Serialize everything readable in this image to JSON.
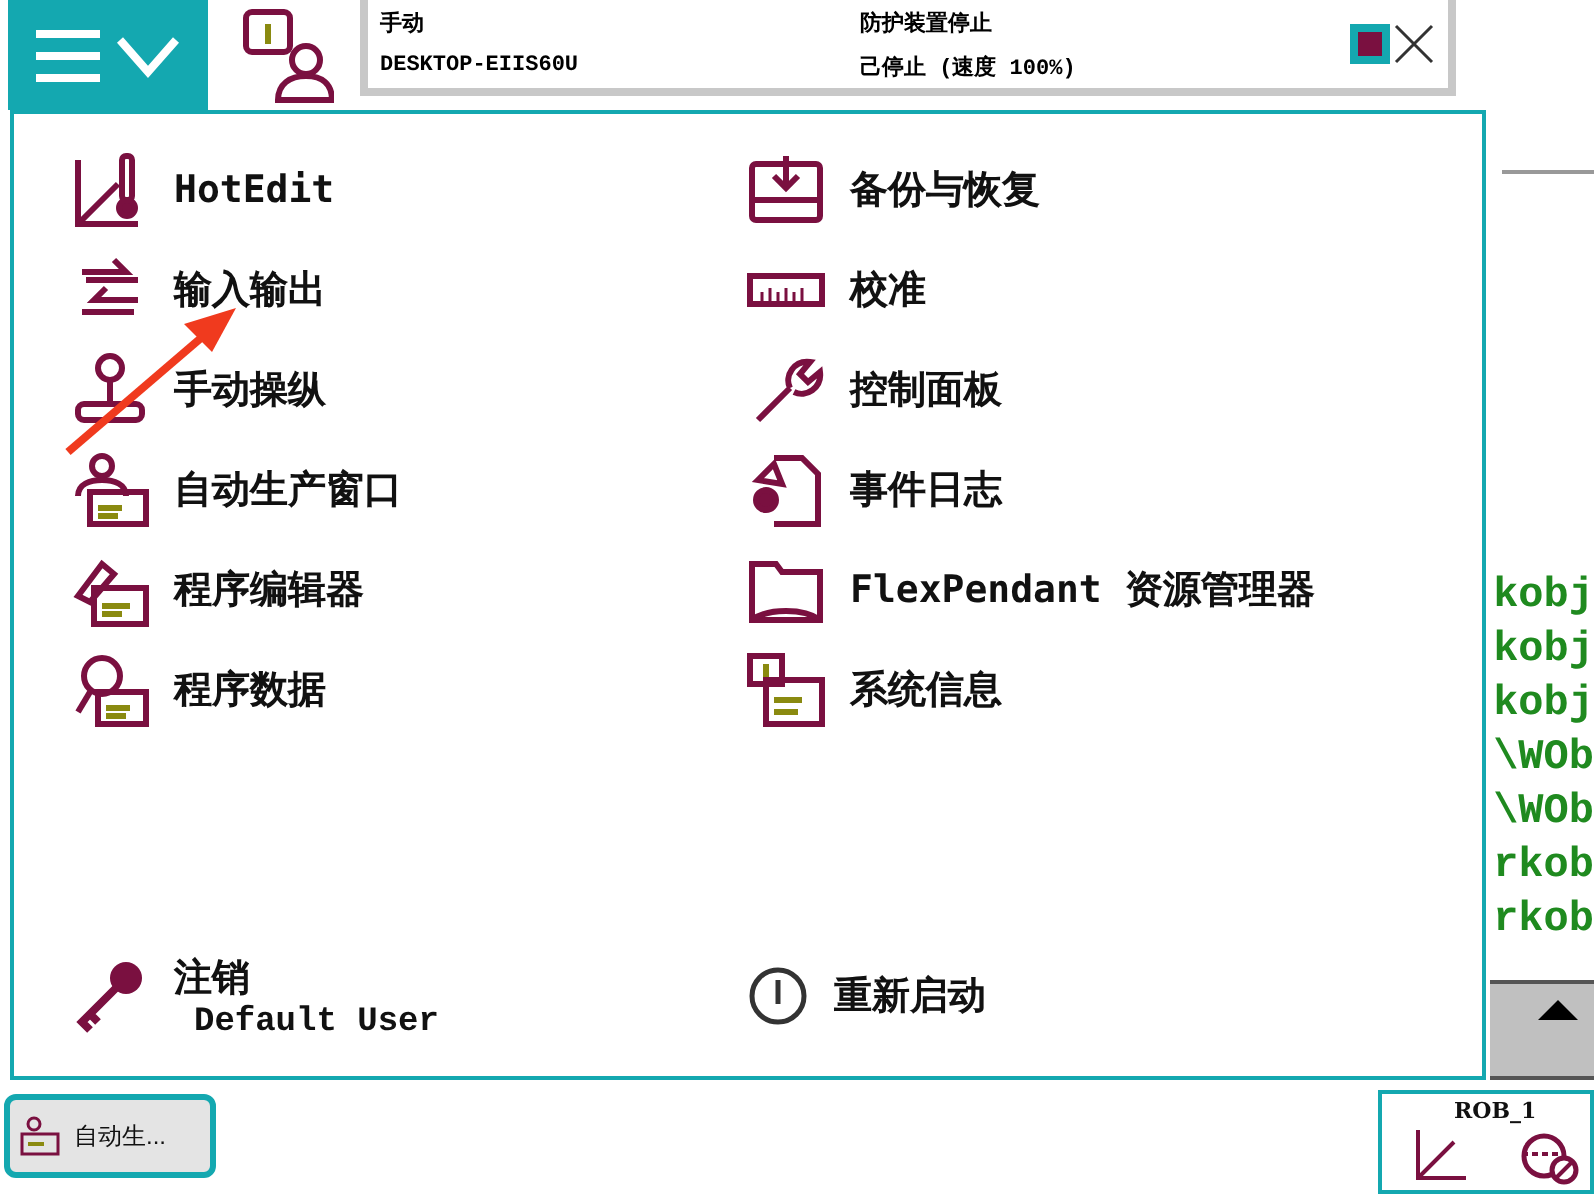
{
  "status": {
    "mode": "手动",
    "system": "DESKTOP-EIIS60U",
    "safety": "防护装置停止",
    "state": "己停止 (速度 100%)"
  },
  "menu": {
    "left": [
      {
        "kind": "hotedit",
        "label": "HotEdit"
      },
      {
        "kind": "io",
        "label": "输入输出"
      },
      {
        "kind": "jog",
        "label": "手动操纵"
      },
      {
        "kind": "production",
        "label": "自动生产窗口"
      },
      {
        "kind": "editor",
        "label": "程序编辑器"
      },
      {
        "kind": "data",
        "label": "程序数据"
      }
    ],
    "right": [
      {
        "kind": "backup",
        "label": "备份与恢复"
      },
      {
        "kind": "calibration",
        "label": "校准"
      },
      {
        "kind": "control",
        "label": "控制面板"
      },
      {
        "kind": "eventlog",
        "label": "事件日志"
      },
      {
        "kind": "explorer",
        "label": "FlexPendant 资源管理器"
      },
      {
        "kind": "sysinfo",
        "label": "系统信息"
      }
    ],
    "logoff": {
      "label": "注销",
      "user": "Default User"
    },
    "restart": {
      "label": "重新启动"
    }
  },
  "code_lines": [
    "kobj",
    "kobj",
    "kobj",
    "\\WOb",
    "\\WOb",
    "rkob",
    "rkob"
  ],
  "taskbar": [
    {
      "label": "自动生..."
    }
  ],
  "robot": {
    "label": "ROB_1"
  }
}
